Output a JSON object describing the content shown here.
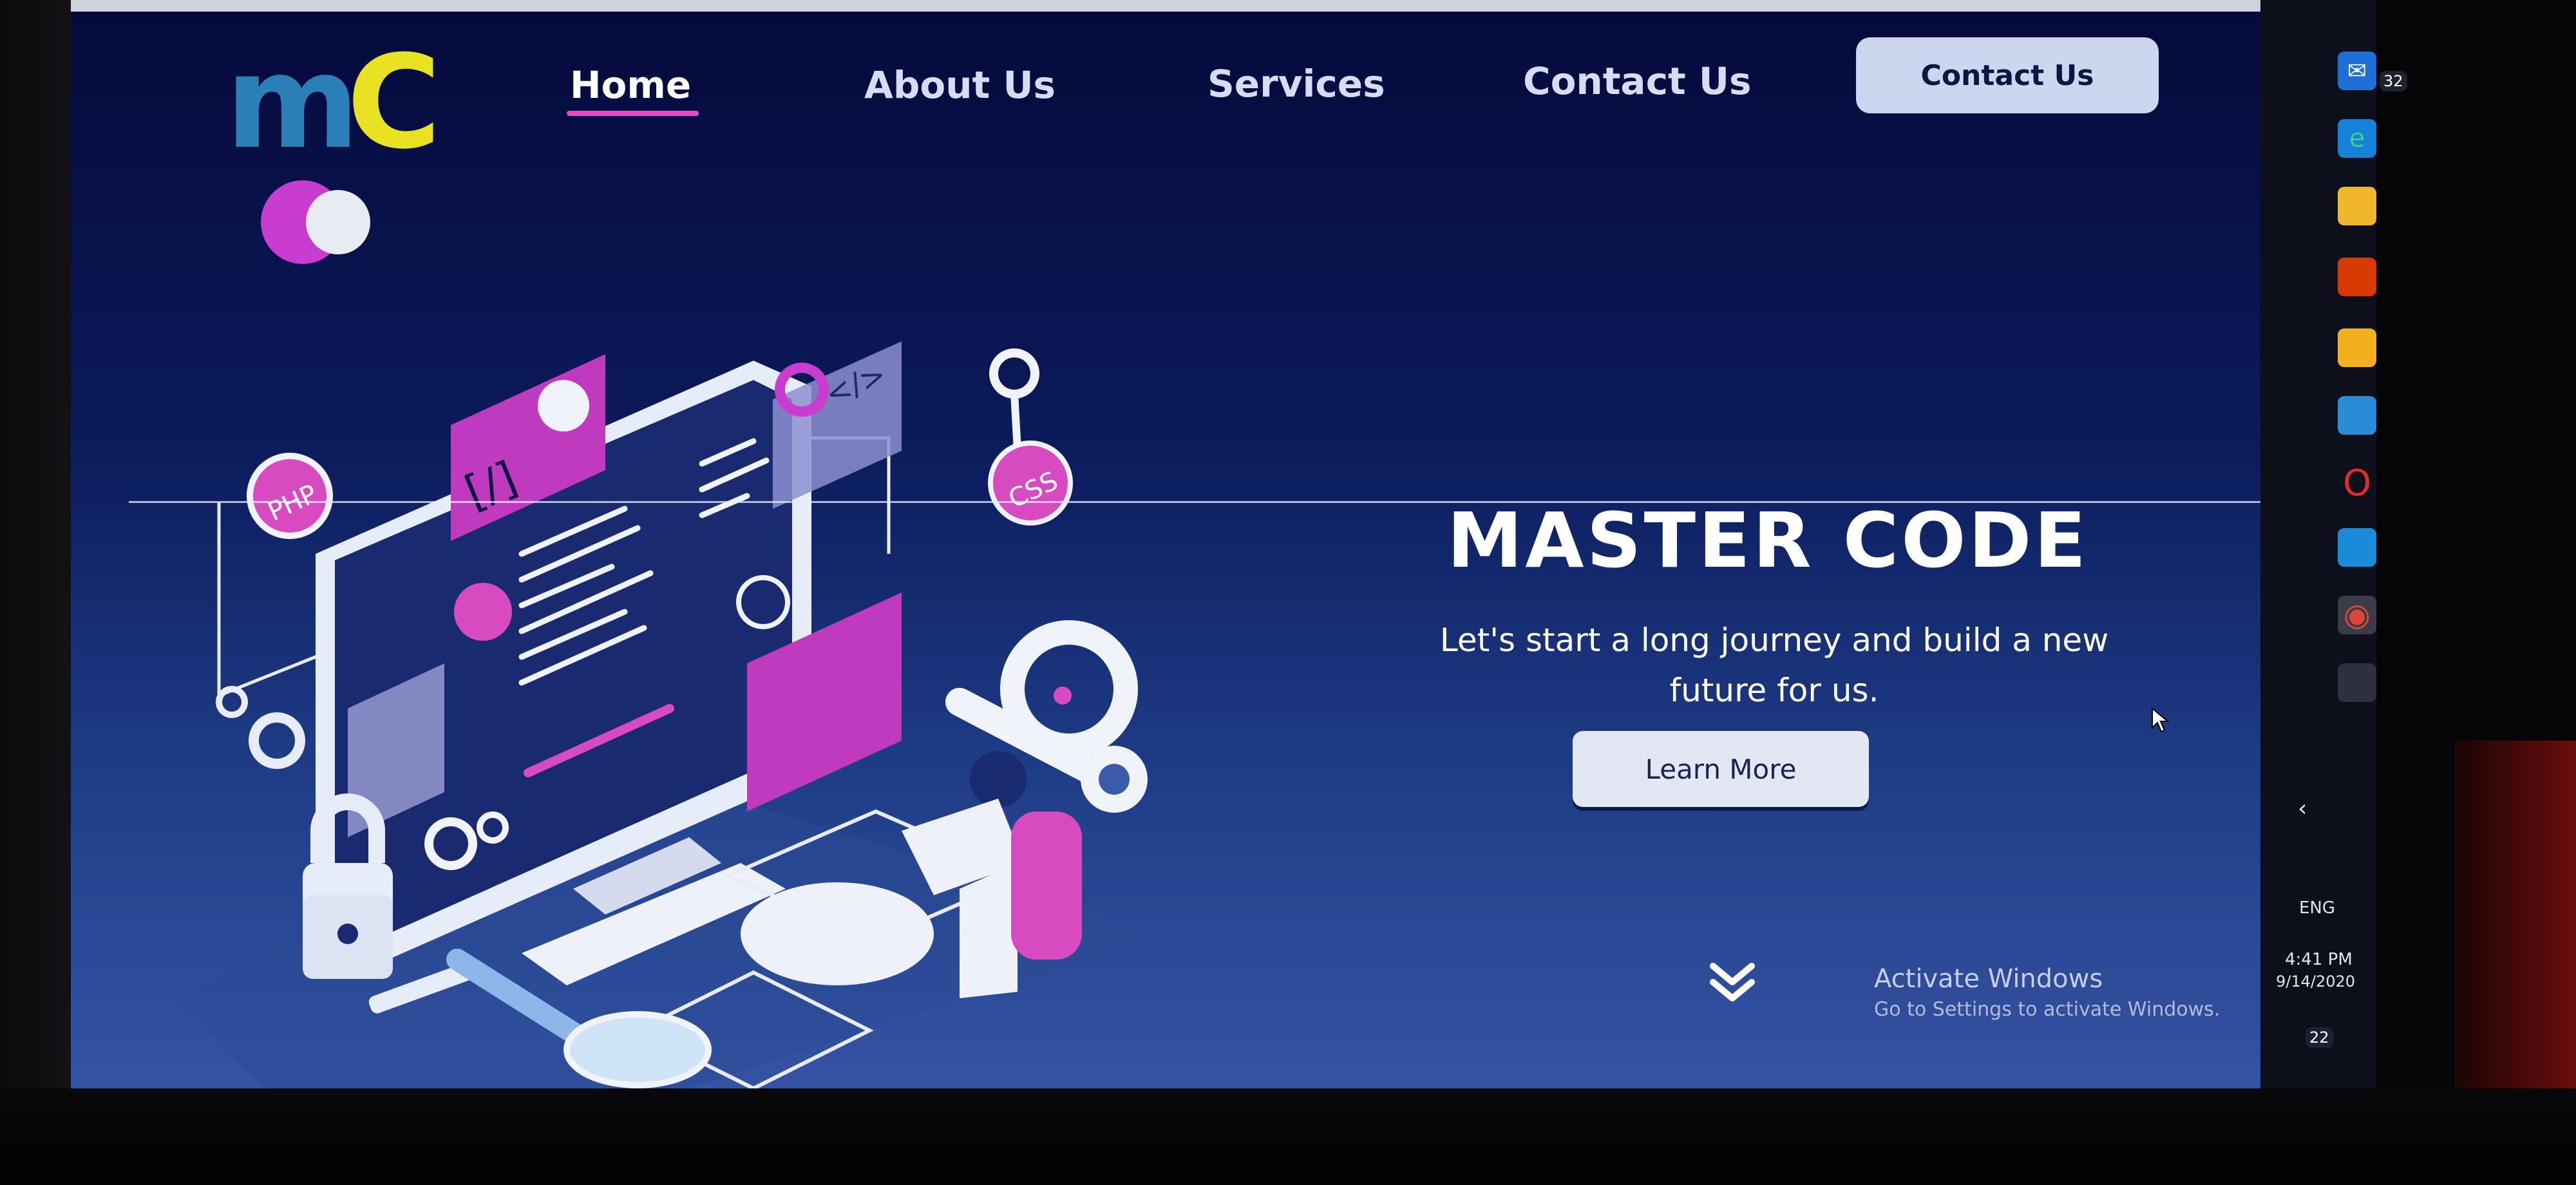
{
  "brand": {
    "logo_text_m": "m",
    "logo_text_c": "C"
  },
  "nav": {
    "home": "Home",
    "about": "About Us",
    "services": "Services",
    "contact": "Contact Us",
    "contact_button": "Contact Us"
  },
  "hero": {
    "title": "MASTER CODE",
    "subtitle_line1": "Let's start a long journey and build a new",
    "subtitle_line2": "future for us.",
    "button": "Learn More"
  },
  "illustration": {
    "php_label": "PHP",
    "css_label": "CSS",
    "code_tag": "</>",
    "bracket_tag": "[/]"
  },
  "windows_watermark": {
    "title": "Activate Windows",
    "subtitle": "Go to Settings to activate Windows."
  },
  "taskbar": {
    "mail_badge": "32",
    "language": "ENG",
    "time": "4:41 PM",
    "date": "9/14/2020",
    "notification_badge": "22",
    "icons": [
      "mail-icon",
      "edge-icon",
      "file-explorer-icon",
      "office-icon",
      "store-icon",
      "app-icon",
      "opera-icon",
      "vscode-icon",
      "chrome-icon",
      "terminal-icon"
    ]
  },
  "colors": {
    "accent_pink": "#e64ac8",
    "logo_blue": "#2b7fb8",
    "logo_yellow": "#e8e223",
    "background_dark": "#05093a",
    "background_light": "#3553a3"
  }
}
